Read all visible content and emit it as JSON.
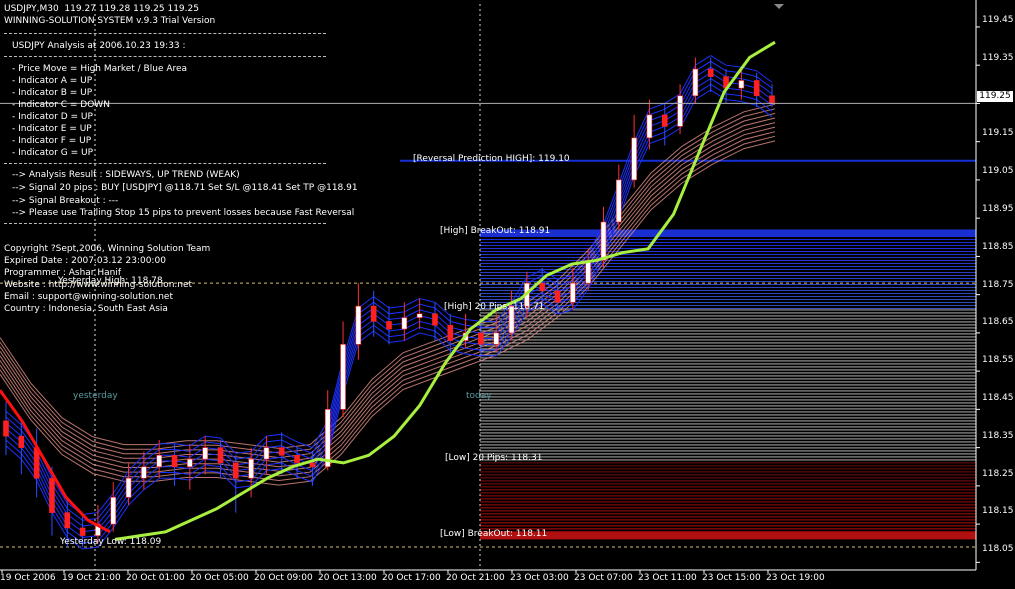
{
  "header": {
    "line1": "USDJPY,M30  119.27 119.28 119.25 119.25",
    "line2": "WINNING-SOLUTION SYSTEM v.9.3 Trial Version"
  },
  "analysis": {
    "title": "USDJPY Analysis at 2006.10.23 19:33 :",
    "indicators": [
      "- Price Move = High Market / Blue Area",
      "- Indicator A = UP",
      "- Indicator B = UP",
      "- Indicator C = DOWN",
      "- Indicator D = UP",
      "- Indicator E = UP",
      "- Indicator F = UP",
      "- Indicator G = UP"
    ],
    "results": [
      "--> Analysis Result : SIDEWAYS, UP TREND (WEAK)",
      "--> Signal 20 pips : BUY [USDJPY] @118.71 Set S/L @118.41 Set TP @118.91",
      "--> Signal Breakout : ---",
      "--> Please use Trailing Stop 15 pips to prevent losses because Fast Reversal"
    ],
    "info": [
      "Copyright ?Sept,2006, Winning Solution Team",
      "Expired Date : 2007.03.12 23:00:00",
      "Programmer : Ashar Hanif",
      "Website : http://www.winning-solution.net",
      "Email : support@winning-solution.net",
      "Country : Indonesia, South East Asia"
    ]
  },
  "chart_data": {
    "type": "line",
    "symbol": "USDJPY",
    "timeframe": "M30",
    "ylim": [
      118.03,
      119.51
    ],
    "y_ticks": [
      119.45,
      119.35,
      119.25,
      119.15,
      119.05,
      118.95,
      118.85,
      118.75,
      118.65,
      118.55,
      118.45,
      118.35,
      118.25,
      118.15,
      118.05
    ],
    "current_price": 119.25,
    "x_tick_labels": [
      "19 Oct 2006",
      "19 Oct 21:00",
      "20 Oct 01:00",
      "20 Oct 05:00",
      "20 Oct 09:00",
      "20 Oct 13:00",
      "20 Oct 17:00",
      "20 Oct 21:00",
      "23 Oct 03:00",
      "23 Oct 07:00",
      "23 Oct 11:00",
      "23 Oct 15:00",
      "23 Oct 19:00"
    ],
    "day_labels": [
      "yesterday",
      "today"
    ],
    "levels": [
      {
        "label": "[Reversal Prediction HIGH]: 119.10",
        "value": 119.1,
        "color": "#1530d8"
      },
      {
        "label": "[High] BreakOut: 118.91",
        "value": 118.91,
        "color": "#1530d8"
      },
      {
        "label": "Yesterday High: 118.78",
        "value": 118.78,
        "color": "#d8c070"
      },
      {
        "label": "[High] 20 Pips: 118.71",
        "value": 118.71,
        "color": "#ffffff"
      },
      {
        "label": "[Low] 20 Pips: 118.31",
        "value": 118.31,
        "color": "#ffffff"
      },
      {
        "label": "[Low] BreakOut: 118.11",
        "value": 118.11,
        "color": "#c01010"
      },
      {
        "label": "Yesterday Low: 118.09",
        "value": 118.09,
        "color": "#d8c070"
      }
    ],
    "series": [
      {
        "color": "#a8f040",
        "values": [
          118.11,
          118.12,
          118.13,
          118.16,
          118.19,
          118.23,
          118.27,
          118.3,
          118.32,
          118.31,
          118.33,
          118.38,
          118.46,
          118.57,
          118.66,
          118.71,
          118.74,
          118.8,
          118.83,
          118.84,
          118.86,
          118.87,
          118.96,
          119.12,
          119.28,
          119.37,
          119.41
        ]
      },
      {
        "color": "#ff1010",
        "values": [
          118.5,
          118.42,
          118.32,
          118.22,
          118.16,
          118.13
        ]
      },
      {
        "color": "#d88a80",
        "values": [
          118.59,
          118.47,
          118.38,
          118.33,
          118.31,
          118.31,
          118.32,
          118.32,
          118.31,
          118.3,
          118.31,
          118.38,
          118.48,
          118.55,
          118.58,
          118.61,
          118.64,
          118.68,
          118.74,
          118.82,
          118.92,
          119.02,
          119.09,
          119.14,
          119.18,
          119.2
        ]
      }
    ],
    "candles": [
      [
        118.42,
        118.38,
        118.47,
        118.33
      ],
      [
        118.38,
        118.35,
        118.42,
        118.28
      ],
      [
        118.35,
        118.27,
        118.4,
        118.22
      ],
      [
        118.27,
        118.18,
        118.3,
        118.12
      ],
      [
        118.18,
        118.14,
        118.22,
        118.09
      ],
      [
        118.14,
        118.12,
        118.18,
        118.09
      ],
      [
        118.12,
        118.15,
        118.2,
        118.1
      ],
      [
        118.15,
        118.22,
        118.26,
        118.13
      ],
      [
        118.22,
        118.27,
        118.31,
        118.2
      ],
      [
        118.27,
        118.3,
        118.34,
        118.24
      ],
      [
        118.3,
        118.33,
        118.37,
        118.27
      ],
      [
        118.33,
        118.3,
        118.36,
        118.25
      ],
      [
        118.3,
        118.32,
        118.36,
        118.24
      ],
      [
        118.32,
        118.35,
        118.38,
        118.28
      ],
      [
        118.35,
        118.31,
        118.37,
        118.27
      ],
      [
        118.31,
        118.27,
        118.33,
        118.18
      ],
      [
        118.27,
        118.32,
        118.35,
        118.22
      ],
      [
        118.32,
        118.35,
        118.38,
        118.28
      ],
      [
        118.35,
        118.33,
        118.39,
        118.28
      ],
      [
        118.33,
        118.31,
        118.35,
        118.27
      ],
      [
        118.31,
        118.3,
        118.34,
        118.25
      ],
      [
        118.3,
        118.45,
        118.5,
        118.29
      ],
      [
        118.45,
        118.62,
        118.68,
        118.43
      ],
      [
        118.62,
        118.72,
        118.78,
        118.58
      ],
      [
        118.72,
        118.68,
        118.76,
        118.64
      ],
      [
        118.68,
        118.66,
        118.72,
        118.62
      ],
      [
        118.66,
        118.69,
        118.73,
        118.63
      ],
      [
        118.69,
        118.7,
        118.74,
        118.66
      ],
      [
        118.7,
        118.67,
        118.73,
        118.63
      ],
      [
        118.67,
        118.63,
        118.7,
        118.58
      ],
      [
        118.63,
        118.65,
        118.7,
        118.61
      ],
      [
        118.65,
        118.62,
        118.68,
        118.59
      ],
      [
        118.62,
        118.65,
        118.7,
        118.6
      ],
      [
        118.65,
        118.72,
        118.76,
        118.63
      ],
      [
        118.72,
        118.78,
        118.81,
        118.69
      ],
      [
        118.78,
        118.76,
        118.82,
        118.72
      ],
      [
        118.76,
        118.73,
        118.79,
        118.7
      ],
      [
        118.73,
        118.78,
        118.82,
        118.71
      ],
      [
        118.78,
        118.84,
        118.87,
        118.76
      ],
      [
        118.84,
        118.94,
        118.98,
        118.82
      ],
      [
        118.94,
        119.05,
        119.09,
        118.92
      ],
      [
        119.05,
        119.16,
        119.22,
        119.03
      ],
      [
        119.16,
        119.22,
        119.26,
        119.13
      ],
      [
        119.22,
        119.19,
        119.25,
        119.14
      ],
      [
        119.19,
        119.27,
        119.3,
        119.17
      ],
      [
        119.27,
        119.34,
        119.37,
        119.25
      ],
      [
        119.34,
        119.32,
        119.37,
        119.28
      ],
      [
        119.32,
        119.29,
        119.34,
        119.25
      ],
      [
        119.29,
        119.31,
        119.34,
        119.26
      ],
      [
        119.31,
        119.27,
        119.33,
        119.24
      ],
      [
        119.27,
        119.25,
        119.3,
        119.24
      ]
    ]
  }
}
